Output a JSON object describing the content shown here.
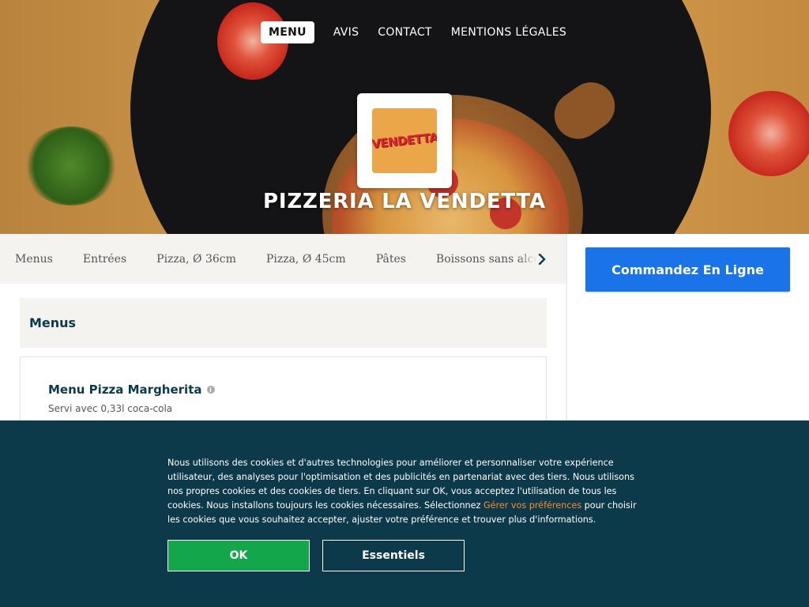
{
  "nav": {
    "items": [
      {
        "label": "MENU",
        "active": true
      },
      {
        "label": "AVIS",
        "active": false
      },
      {
        "label": "CONTACT",
        "active": false
      },
      {
        "label": "MENTIONS LÉGALES",
        "active": false
      }
    ]
  },
  "brand": {
    "logo_text": "VENDETTA",
    "logo_bg_color": "#eba64a",
    "name": "PIZZERIA LA VENDETTA"
  },
  "categories": [
    "Menus",
    "Entrées",
    "Pizza, Ø 36cm",
    "Pizza, Ø 45cm",
    "Pâtes",
    "Boissons sans alcoo"
  ],
  "category_scroll_icon": "chevron-right-icon",
  "order": {
    "label": "Commandez En Ligne",
    "color": "#1a73e8"
  },
  "section": {
    "title": "Menus",
    "items": [
      {
        "name": "Menu Pizza Margherita",
        "info_icon": "info-icon",
        "description": "Servi avec 0,33l coca-cola"
      }
    ]
  },
  "cookie": {
    "text_before": "Nous utilisons des cookies et d'autres technologies pour améliorer et personnaliser votre expérience utilisateur, des analyses pour l'optimisation et des publicités en partenariat avec des tiers. Nous utilisons nos propres cookies et des cookies de tiers. En cliquant sur OK, vous acceptez l'utilisation de tous les cookies. Nous installons toujours les cookies nécessaires. Sélectionnez ",
    "link": "Gérer vos préférences",
    "text_after": " pour choisir les cookies que vous souhaitez accepter, ajuster votre préférence et trouver plus d'informations.",
    "ok_label": "OK",
    "essentials_label": "Essentiels",
    "bg_color": "#0d3a4a",
    "ok_color": "#14a64a",
    "link_color": "#ff8a2a"
  }
}
